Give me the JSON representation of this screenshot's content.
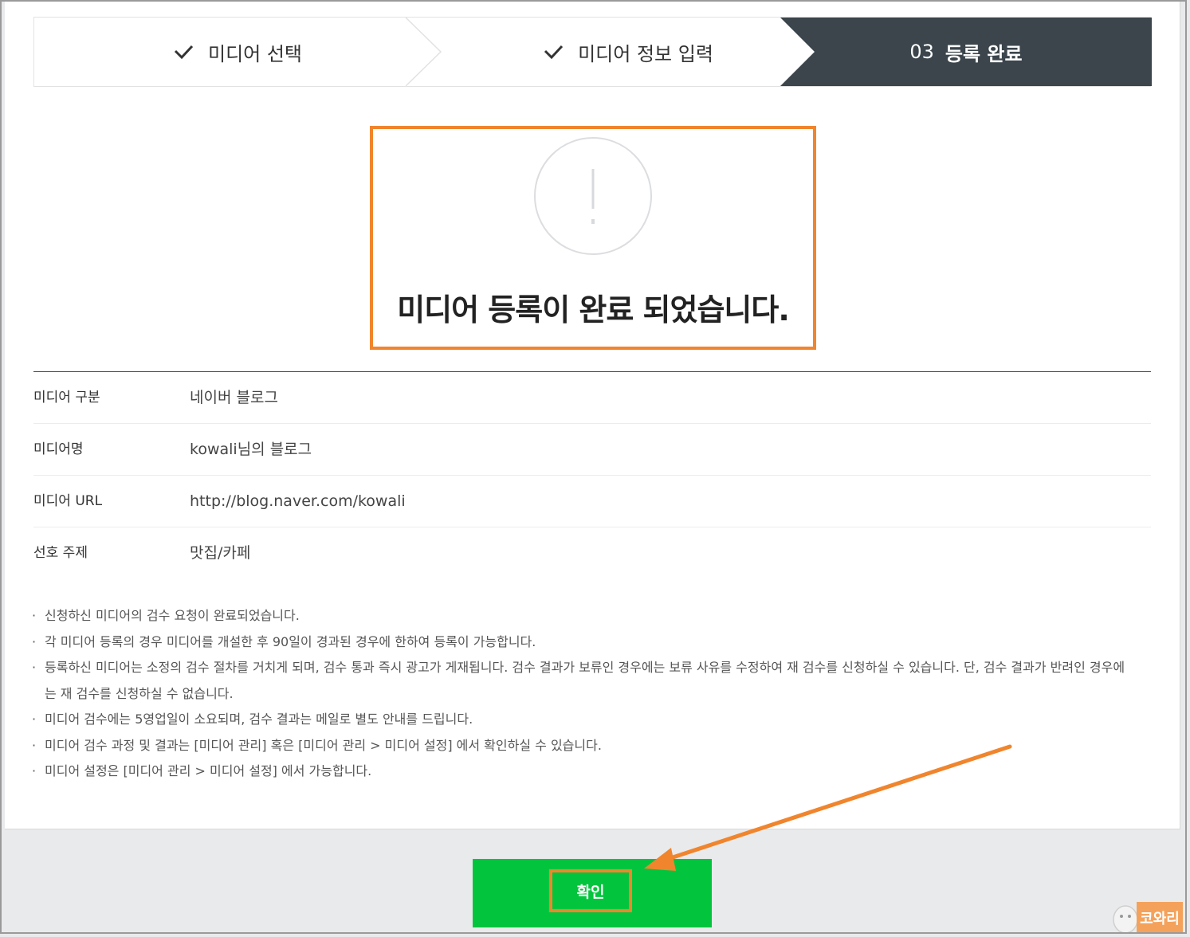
{
  "steps": [
    {
      "label": "미디어 선택",
      "state": "done"
    },
    {
      "label": "미디어 정보 입력",
      "state": "done"
    },
    {
      "number": "03",
      "label": "등록 완료",
      "state": "active"
    }
  ],
  "completion": {
    "message": "미디어 등록이 완료 되었습니다.",
    "icon": "exclamation-icon"
  },
  "info": [
    {
      "label": "미디어 구분",
      "value": "네이버 블로그"
    },
    {
      "label": "미디어명",
      "value": "kowali님의 블로그"
    },
    {
      "label": "미디어 URL",
      "value": "http://blog.naver.com/kowali"
    },
    {
      "label": "선호 주제",
      "value": "맛집/카페"
    }
  ],
  "notes": [
    "신청하신 미디어의 검수 요청이 완료되었습니다.",
    "각 미디어 등록의 경우 미디어를 개설한 후 90일이 경과된 경우에 한하여 등록이 가능합니다.",
    "등록하신 미디어는 소정의 검수 절차를 거치게 되며, 검수 통과 즉시 광고가 게재됩니다. 검수 결과가 보류인 경우에는 보류 사유를 수정하여 재 검수를 신청하실 수 있습니다. 단, 검수 결과가 반려인 경우에는 재 검수를 신청하실 수 없습니다.",
    "미디어 검수에는 5영업일이 소요되며, 검수 결과는 메일로 별도 안내를 드립니다.",
    "미디어 검수 과정 및 결과는 [미디어 관리] 혹은 [미디어 관리 > 미디어 설정] 에서 확인하실 수 있습니다.",
    "미디어 설정은 [미디어 관리 > 미디어 설정] 에서 가능합니다."
  ],
  "confirm_label": "확인",
  "watermark": "코와리",
  "colors": {
    "active_step": "#3b454b",
    "highlight": "#f0852d",
    "confirm_button": "#03c43d"
  }
}
